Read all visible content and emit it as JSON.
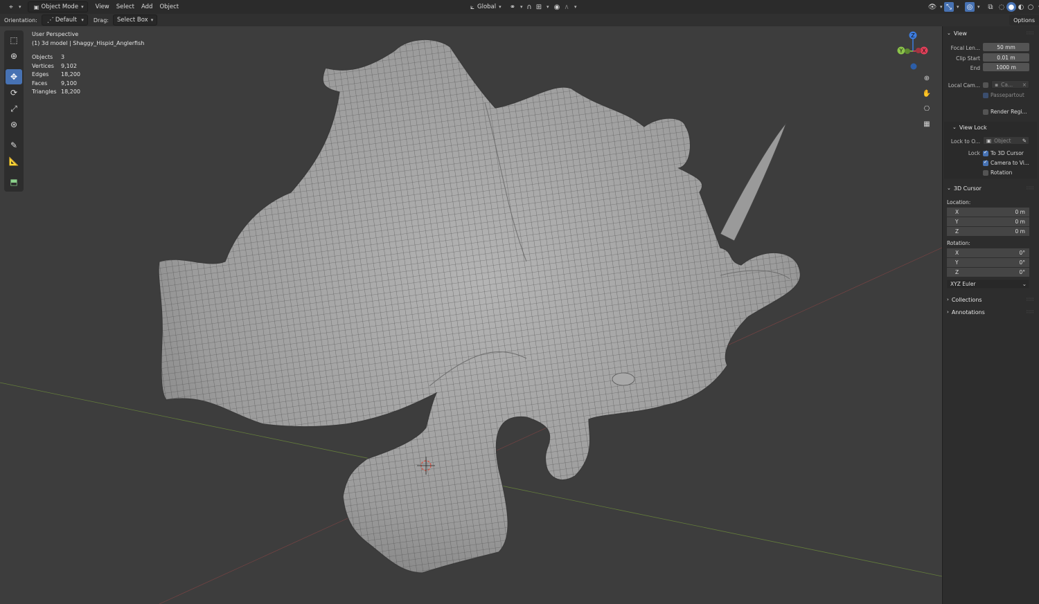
{
  "header": {
    "mode": "Object Mode",
    "menus": [
      "View",
      "Select",
      "Add",
      "Object"
    ],
    "transform_orientation": "Global",
    "orientation_label": "Orientation:",
    "orientation_value": "Default",
    "drag_label": "Drag:",
    "drag_value": "Select Box",
    "options_label": "Options"
  },
  "overlay": {
    "view_name": "User Perspective",
    "object_name": "(1) 3d model | Shaggy_Hispid_Anglerfish",
    "stats": [
      {
        "label": "Objects",
        "value": "3"
      },
      {
        "label": "Vertices",
        "value": "9,102"
      },
      {
        "label": "Edges",
        "value": "18,200"
      },
      {
        "label": "Faces",
        "value": "9,100"
      },
      {
        "label": "Triangles",
        "value": "18,200"
      }
    ]
  },
  "gizmo": {
    "z": "Z",
    "y": "Y",
    "x": "X"
  },
  "panel": {
    "view": {
      "title": "View",
      "focal_label": "Focal Len...",
      "focal_value": "50 mm",
      "clip_start_label": "Clip Start",
      "clip_start_value": "0.01 m",
      "end_label": "End",
      "end_value": "1000 m",
      "local_cam_label": "Local Cam...",
      "local_cam_value": "Ca...",
      "passepartout": "Passepartout",
      "render_region": "Render Regi..."
    },
    "view_lock": {
      "title": "View Lock",
      "lock_to_label": "Lock to O...",
      "lock_to_placeholder": "Object",
      "lock_label": "Lock",
      "to_cursor": "To 3D Cursor",
      "camera_to_view": "Camera to Vi...",
      "rotation": "Rotation"
    },
    "cursor": {
      "title": "3D Cursor",
      "location_label": "Location:",
      "location": [
        {
          "axis": "X",
          "value": "0 m"
        },
        {
          "axis": "Y",
          "value": "0 m"
        },
        {
          "axis": "Z",
          "value": "0 m"
        }
      ],
      "rotation_label": "Rotation:",
      "rotation": [
        {
          "axis": "X",
          "value": "0°"
        },
        {
          "axis": "Y",
          "value": "0°"
        },
        {
          "axis": "Z",
          "value": "0°"
        }
      ],
      "rotation_mode": "XYZ Euler"
    },
    "collections": "Collections",
    "annotations": "Annotations"
  },
  "colors": {
    "accent": "#4772b3",
    "axis_x": "#e4405a",
    "axis_y": "#8bc34a",
    "axis_z": "#3d7de0",
    "mesh": "#9a9a9a"
  }
}
